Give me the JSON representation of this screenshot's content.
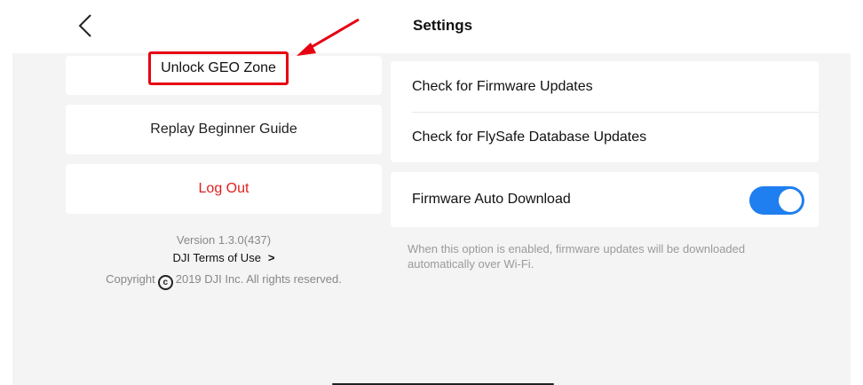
{
  "header": {
    "title": "Settings"
  },
  "left": {
    "unlock_geo": "Unlock GEO Zone",
    "replay_guide": "Replay Beginner Guide",
    "logout": "Log Out",
    "version": "Version 1.3.0(437)",
    "terms": "DJI Terms of Use",
    "copyright_pre": "Copyright",
    "copyright_post": "2019 DJI Inc. All rights reserved."
  },
  "right": {
    "check_firmware": "Check for Firmware Updates",
    "check_flysafe": "Check for FlySafe Database Updates",
    "auto_download_label": "Firmware Auto Download",
    "auto_download_enabled": true,
    "hint": "When this option is enabled, firmware updates will be downloaded automatically over Wi-Fi."
  },
  "colors": {
    "toggle_on": "#1f7ff0",
    "logout_red": "#e02020",
    "highlight_red": "#e60012"
  }
}
